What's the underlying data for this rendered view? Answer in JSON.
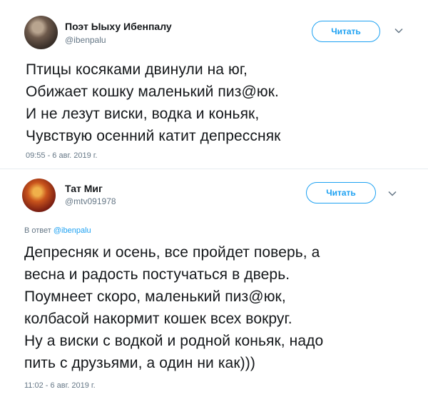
{
  "tweets": [
    {
      "display_name": "Поэт Ыыху Ибенпалу",
      "handle": "@ibenpalu",
      "follow_label": "Читать",
      "text": "Птицы косяками двинули на юг,\nОбижает кошку маленький пиз@юк.\nИ не лезут виски, водка и коньяк,\nЧувствую осенний катит депрессняк",
      "timestamp": "09:55 - 6 авг. 2019 г.",
      "icons": {
        "avatar": "user-avatar",
        "more": "chevron-down-icon"
      }
    },
    {
      "display_name": "Тат Миг",
      "handle": "@mtv091978",
      "follow_label": "Читать",
      "reply_prefix": "В ответ",
      "reply_mention": "@ibenpalu",
      "text": "Депресняк и осень, все пройдет поверь, а\nвесна и радость постучаться в дверь.\nПоумнеет скоро, маленький пиз@юк,\nколбасой накормит кошек всех вокруг.\nНу а виски с водкой и родной коньяк, надо\nпить с друзьями, а один ни как)))",
      "timestamp": "11:02 - 6 авг. 2019 г.",
      "icons": {
        "avatar": "user-avatar",
        "more": "chevron-down-icon"
      }
    }
  ],
  "colors": {
    "accent": "#1da1f2",
    "secondary_text": "#657786",
    "primary_text": "#14171a",
    "divider": "#e6ecf0"
  }
}
